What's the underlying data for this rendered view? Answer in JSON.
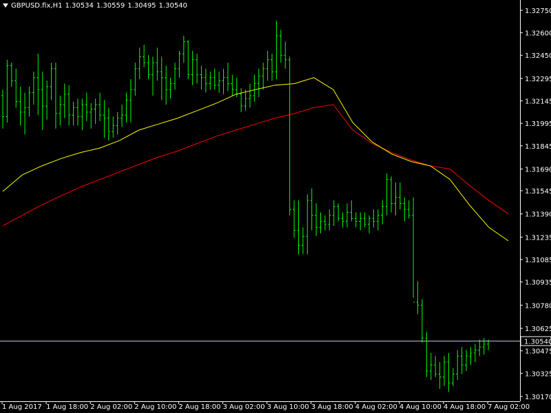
{
  "header": {
    "menu_icon": "triangle-down-icon",
    "symbol": "GBPUSD.fix,H1",
    "open": "1.30534",
    "high": "1.30559",
    "low": "1.30495",
    "close": "1.30540"
  },
  "colors": {
    "background": "#000000",
    "bars": "#00ff00",
    "axes": "#ffffff",
    "ma_fast": "#ffff00",
    "ma_slow": "#ff0000",
    "price_line": "#b4c8dc",
    "price_label_bg": "#000000"
  },
  "chart_data": {
    "type": "ohlc",
    "symbol": "GBPUSD.fix",
    "timeframe": "H1",
    "y_ticks": [
      "1.32750",
      "1.32600",
      "1.32450",
      "1.32295",
      "1.32145",
      "1.31995",
      "1.31845",
      "1.31690",
      "1.31545",
      "1.31390",
      "1.31235",
      "1.31085",
      "1.30935",
      "1.30780",
      "1.30625",
      "1.30475",
      "1.30325",
      "1.30170"
    ],
    "ylim": [
      1.3017,
      1.3275
    ],
    "current_price": "1.30540",
    "x_ticks": [
      "1 Aug 2017",
      "1 Aug 18:00",
      "2 Aug 02:00",
      "2 Aug 10:00",
      "2 Aug 18:00",
      "3 Aug 02:00",
      "3 Aug 10:00",
      "3 Aug 18:00",
      "4 Aug 02:00",
      "4 Aug 10:00",
      "4 Aug 18:00",
      "7 Aug 02:00"
    ],
    "bars": [
      [
        1.3218,
        1.3222,
        1.3196,
        1.3204
      ],
      [
        1.3204,
        1.3242,
        1.32,
        1.3238
      ],
      [
        1.3238,
        1.324,
        1.3224,
        1.3228
      ],
      [
        1.3228,
        1.3236,
        1.321,
        1.3214
      ],
      [
        1.3214,
        1.3224,
        1.3198,
        1.3207
      ],
      [
        1.3207,
        1.322,
        1.3192,
        1.321
      ],
      [
        1.321,
        1.3224,
        1.3204,
        1.322
      ],
      [
        1.322,
        1.3234,
        1.3212,
        1.323
      ],
      [
        1.323,
        1.3246,
        1.3205,
        1.3222
      ],
      [
        1.3222,
        1.3234,
        1.3195,
        1.3211
      ],
      [
        1.3211,
        1.3228,
        1.3202,
        1.3224
      ],
      [
        1.3224,
        1.324,
        1.3215,
        1.3236
      ],
      [
        1.3236,
        1.324,
        1.3196,
        1.3206
      ],
      [
        1.3206,
        1.3218,
        1.3198,
        1.3212
      ],
      [
        1.3212,
        1.3226,
        1.3203,
        1.3219
      ],
      [
        1.3219,
        1.3225,
        1.3198,
        1.3205
      ],
      [
        1.3205,
        1.3214,
        1.3198,
        1.321
      ],
      [
        1.321,
        1.3216,
        1.3198,
        1.3204
      ],
      [
        1.3204,
        1.3216,
        1.3195,
        1.3212
      ],
      [
        1.3212,
        1.322,
        1.3201,
        1.3207
      ],
      [
        1.3207,
        1.3213,
        1.3196,
        1.3209
      ],
      [
        1.3209,
        1.3216,
        1.3199,
        1.3212
      ],
      [
        1.3212,
        1.322,
        1.3201,
        1.3205
      ],
      [
        1.3205,
        1.3215,
        1.319,
        1.3203
      ],
      [
        1.3203,
        1.321,
        1.3188,
        1.3194
      ],
      [
        1.3194,
        1.3204,
        1.319,
        1.3198
      ],
      [
        1.3198,
        1.3207,
        1.3192,
        1.3203
      ],
      [
        1.3203,
        1.3212,
        1.3197,
        1.3205
      ],
      [
        1.3205,
        1.322,
        1.32,
        1.3215
      ],
      [
        1.3215,
        1.3229,
        1.32,
        1.3222
      ],
      [
        1.3222,
        1.324,
        1.3218,
        1.3236
      ],
      [
        1.3236,
        1.325,
        1.3229,
        1.3244
      ],
      [
        1.3244,
        1.3252,
        1.3237,
        1.324
      ],
      [
        1.324,
        1.3245,
        1.3229,
        1.3232
      ],
      [
        1.3232,
        1.3244,
        1.3218,
        1.324
      ],
      [
        1.324,
        1.325,
        1.3228,
        1.3234
      ],
      [
        1.3234,
        1.3244,
        1.3215,
        1.323
      ],
      [
        1.323,
        1.3238,
        1.3212,
        1.3222
      ],
      [
        1.3222,
        1.323,
        1.3216,
        1.3226
      ],
      [
        1.3226,
        1.324,
        1.3222,
        1.3236
      ],
      [
        1.3236,
        1.3248,
        1.323,
        1.3246
      ],
      [
        1.3246,
        1.3258,
        1.324,
        1.3254
      ],
      [
        1.3254,
        1.3255,
        1.3229,
        1.3232
      ],
      [
        1.3232,
        1.3248,
        1.3225,
        1.3242
      ],
      [
        1.3242,
        1.3246,
        1.3226,
        1.3232
      ],
      [
        1.3232,
        1.3238,
        1.3222,
        1.323
      ],
      [
        1.323,
        1.3236,
        1.322,
        1.3226
      ],
      [
        1.3226,
        1.3234,
        1.3222,
        1.323
      ],
      [
        1.323,
        1.3236,
        1.3222,
        1.3225
      ],
      [
        1.3225,
        1.3234,
        1.322,
        1.3228
      ],
      [
        1.3228,
        1.3236,
        1.3219,
        1.323
      ],
      [
        1.323,
        1.324,
        1.3221,
        1.3226
      ],
      [
        1.3226,
        1.3232,
        1.3218,
        1.3222
      ],
      [
        1.3222,
        1.323,
        1.3217,
        1.3219
      ],
      [
        1.3219,
        1.3223,
        1.3207,
        1.3211
      ],
      [
        1.3211,
        1.3222,
        1.3208,
        1.3216
      ],
      [
        1.3216,
        1.3226,
        1.321,
        1.3218
      ],
      [
        1.3218,
        1.3232,
        1.3214,
        1.3226
      ],
      [
        1.3226,
        1.3236,
        1.3217,
        1.3231
      ],
      [
        1.3231,
        1.324,
        1.3222,
        1.3236
      ],
      [
        1.3236,
        1.3248,
        1.3228,
        1.3242
      ],
      [
        1.3242,
        1.3246,
        1.3228,
        1.3234
      ],
      [
        1.3234,
        1.3268,
        1.3229,
        1.3258
      ],
      [
        1.3258,
        1.3262,
        1.324,
        1.3245
      ],
      [
        1.3245,
        1.3254,
        1.3236,
        1.3242
      ],
      [
        1.3242,
        1.3244,
        1.3138,
        1.3142
      ],
      [
        1.3142,
        1.3148,
        1.3123,
        1.3128
      ],
      [
        1.3128,
        1.3148,
        1.3112,
        1.3118
      ],
      [
        1.3118,
        1.313,
        1.3112,
        1.3124
      ],
      [
        1.3124,
        1.3152,
        1.3112,
        1.3148
      ],
      [
        1.3148,
        1.3156,
        1.3128,
        1.3138
      ],
      [
        1.3138,
        1.3146,
        1.3124,
        1.313
      ],
      [
        1.313,
        1.314,
        1.3126,
        1.3134
      ],
      [
        1.3134,
        1.3138,
        1.3128,
        1.3132
      ],
      [
        1.3132,
        1.3142,
        1.3128,
        1.3138
      ],
      [
        1.3138,
        1.3148,
        1.3131,
        1.3144
      ],
      [
        1.3144,
        1.3146,
        1.3134,
        1.3136
      ],
      [
        1.3136,
        1.314,
        1.313,
        1.3134
      ],
      [
        1.3134,
        1.3146,
        1.313,
        1.314
      ],
      [
        1.314,
        1.3148,
        1.3134,
        1.3136
      ],
      [
        1.3136,
        1.314,
        1.313,
        1.3134
      ],
      [
        1.3134,
        1.314,
        1.3128,
        1.3136
      ],
      [
        1.3136,
        1.314,
        1.313,
        1.3132
      ],
      [
        1.3132,
        1.3138,
        1.3126,
        1.3136
      ],
      [
        1.3136,
        1.3142,
        1.313,
        1.3134
      ],
      [
        1.3134,
        1.3142,
        1.3128,
        1.3138
      ],
      [
        1.3138,
        1.3148,
        1.3132,
        1.3144
      ],
      [
        1.3144,
        1.3166,
        1.3138,
        1.3162
      ],
      [
        1.3162,
        1.3164,
        1.314,
        1.3146
      ],
      [
        1.3146,
        1.316,
        1.3138,
        1.315
      ],
      [
        1.315,
        1.316,
        1.3142,
        1.3146
      ],
      [
        1.3146,
        1.315,
        1.3134,
        1.3142
      ],
      [
        1.3142,
        1.3148,
        1.3136,
        1.3138
      ],
      [
        1.3138,
        1.315,
        1.3083,
        1.308
      ],
      [
        1.308,
        1.3094,
        1.3072,
        1.3078
      ],
      [
        1.3078,
        1.3082,
        1.3053,
        1.3056
      ],
      [
        1.3056,
        1.306,
        1.303,
        1.3034
      ],
      [
        1.3034,
        1.3046,
        1.3028,
        1.3038
      ],
      [
        1.3038,
        1.3044,
        1.303,
        1.3032
      ],
      [
        1.3032,
        1.304,
        1.3022,
        1.303
      ],
      [
        1.303,
        1.3044,
        1.3024,
        1.304
      ],
      [
        1.304,
        1.3046,
        1.302,
        1.3026
      ],
      [
        1.3026,
        1.3036,
        1.3024,
        1.3032
      ],
      [
        1.3032,
        1.3048,
        1.3028,
        1.3044
      ],
      [
        1.3044,
        1.305,
        1.3032,
        1.3038
      ],
      [
        1.3038,
        1.3048,
        1.3034,
        1.3044
      ],
      [
        1.3044,
        1.305,
        1.3038,
        1.3046
      ],
      [
        1.3046,
        1.3052,
        1.304,
        1.3048
      ],
      [
        1.3048,
        1.3055,
        1.3044,
        1.305
      ],
      [
        1.305,
        1.3056,
        1.3045,
        1.3052
      ],
      [
        1.3052,
        1.3055,
        1.3048,
        1.3054
      ]
    ],
    "ma_fast": [
      1.3154,
      1.3165,
      1.3171,
      1.3176,
      1.318,
      1.3183,
      1.3188,
      1.3195,
      1.3199,
      1.3203,
      1.3208,
      1.3213,
      1.3219,
      1.3222,
      1.3225,
      1.3226,
      1.323,
      1.3222,
      1.32,
      1.3187,
      1.3179,
      1.3174,
      1.3171,
      1.3162,
      1.3145,
      1.313,
      1.3121
    ],
    "ma_slow": [
      1.3131,
      1.3138,
      1.3145,
      1.3151,
      1.3157,
      1.3162,
      1.3167,
      1.3172,
      1.3177,
      1.3181,
      1.3186,
      1.3191,
      1.3195,
      1.3199,
      1.3203,
      1.3206,
      1.321,
      1.3212,
      1.3195,
      1.3186,
      1.318,
      1.3175,
      1.3171,
      1.3169,
      1.3158,
      1.3148,
      1.3139
    ]
  }
}
